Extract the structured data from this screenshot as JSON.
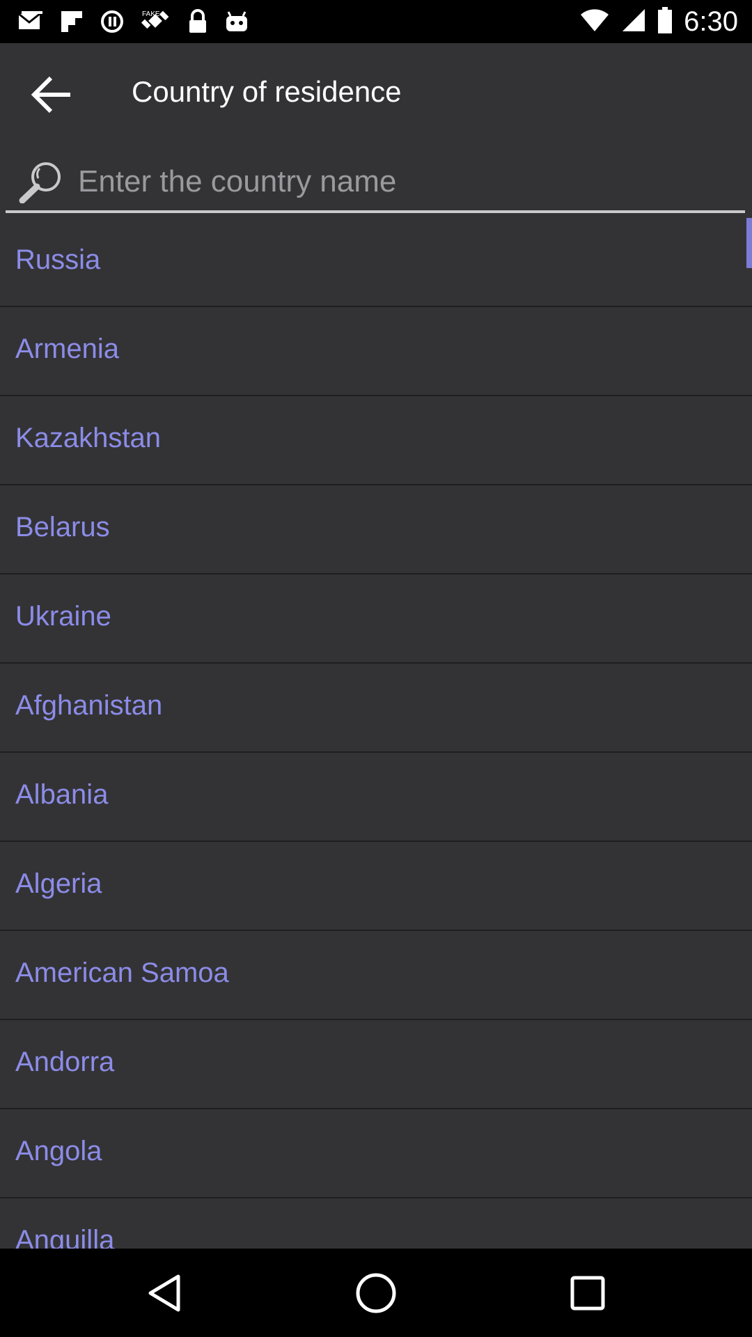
{
  "status_bar": {
    "time": "6:30",
    "left_icons": [
      "mail-icon",
      "flipboard-icon",
      "circle-status-icon",
      "satellite-fake-gps-icon",
      "lock-icon",
      "android-robot-icon"
    ],
    "fake_gps_label": "FAKE",
    "right_icons": [
      "wifi-icon",
      "signal-icon",
      "battery-icon"
    ]
  },
  "toolbar": {
    "title": "Country of residence",
    "back_icon": "arrow-left-icon"
  },
  "search": {
    "placeholder": "Enter the country name",
    "value": "",
    "icon": "search-icon"
  },
  "countries": [
    "Russia",
    "Armenia",
    "Kazakhstan",
    "Belarus",
    "Ukraine",
    "Afghanistan",
    "Albania",
    "Algeria",
    "American Samoa",
    "Andorra",
    "Angola",
    "Anguilla"
  ],
  "nav_bar": {
    "items": [
      "back-triangle-icon",
      "home-circle-icon",
      "recents-square-icon"
    ]
  },
  "colors": {
    "background": "#333336",
    "country_text": "#8c8ce8",
    "divider": "#1e1e20",
    "scroll_thumb": "#7c7cd6"
  }
}
